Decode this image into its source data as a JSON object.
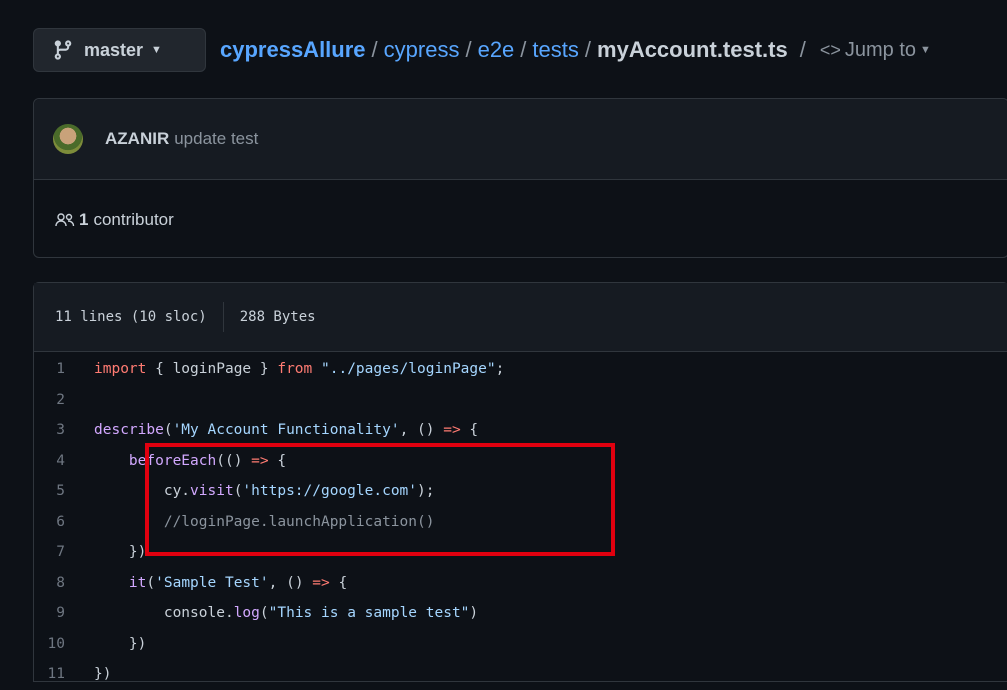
{
  "branch": {
    "label": "master",
    "icon": "git-branch-icon"
  },
  "breadcrumb": {
    "repo": "cypressAllure",
    "parts": [
      "cypress",
      "e2e",
      "tests"
    ],
    "file": "myAccount.test.ts",
    "separator": "/",
    "jump_label": "Jump to"
  },
  "commit": {
    "author": "AZANIR",
    "message": "update test"
  },
  "contributors": {
    "count": "1",
    "label": "contributor"
  },
  "file_info": {
    "lines": "11 lines (10 sloc)",
    "size": "288 Bytes"
  },
  "code_lines": [
    {
      "n": "1",
      "tokens": [
        [
          "kw",
          "import"
        ],
        [
          "pl",
          " { loginPage } "
        ],
        [
          "kw",
          "from"
        ],
        [
          "pl",
          " "
        ],
        [
          "str",
          "\"../pages/loginPage\""
        ],
        [
          "pl",
          ";"
        ]
      ]
    },
    {
      "n": "2",
      "tokens": []
    },
    {
      "n": "3",
      "tokens": [
        [
          "fn",
          "describe"
        ],
        [
          "pl",
          "("
        ],
        [
          "str",
          "'My Account Functionality'"
        ],
        [
          "pl",
          ", () "
        ],
        [
          "op",
          "=>"
        ],
        [
          "pl",
          " {"
        ]
      ]
    },
    {
      "n": "4",
      "tokens": [
        [
          "pl",
          "    "
        ],
        [
          "fn",
          "beforeEach"
        ],
        [
          "pl",
          "(() "
        ],
        [
          "op",
          "=>"
        ],
        [
          "pl",
          " {"
        ]
      ]
    },
    {
      "n": "5",
      "tokens": [
        [
          "pl",
          "        cy."
        ],
        [
          "fn",
          "visit"
        ],
        [
          "pl",
          "("
        ],
        [
          "str",
          "'https://google.com'"
        ],
        [
          "pl",
          ");"
        ]
      ]
    },
    {
      "n": "6",
      "tokens": [
        [
          "cm",
          "        //loginPage.launchApplication()"
        ]
      ]
    },
    {
      "n": "7",
      "tokens": [
        [
          "pl",
          "    })"
        ]
      ]
    },
    {
      "n": "8",
      "tokens": [
        [
          "pl",
          "    "
        ],
        [
          "fn",
          "it"
        ],
        [
          "pl",
          "("
        ],
        [
          "str",
          "'Sample Test'"
        ],
        [
          "pl",
          ", () "
        ],
        [
          "op",
          "=>"
        ],
        [
          "pl",
          " {"
        ]
      ]
    },
    {
      "n": "9",
      "tokens": [
        [
          "pl",
          "        console."
        ],
        [
          "fn",
          "log"
        ],
        [
          "pl",
          "("
        ],
        [
          "str",
          "\"This is a sample test\""
        ],
        [
          "pl",
          ")"
        ]
      ]
    },
    {
      "n": "10",
      "tokens": [
        [
          "pl",
          "    })"
        ]
      ]
    },
    {
      "n": "11",
      "tokens": [
        [
          "pl",
          "})"
        ]
      ]
    }
  ],
  "colors": {
    "highlight": "#e0000f",
    "link": "#58a6ff",
    "background": "#0d1117"
  }
}
